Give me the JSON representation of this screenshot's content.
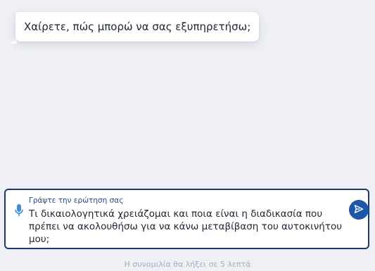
{
  "chat": {
    "bot_message": "Χαίρετε, πώς μπορώ να σας εξυπηρετήσω;"
  },
  "composer": {
    "label": "Γράψτε την ερώτηση σας",
    "value": "Τι δικαιολογητικά χρειάζομαι και ποια είναι η διαδικασία που πρέπει να ακολουθήσω για να κάνω μεταβίβαση του αυτοκινήτου μου;",
    "mic_icon": "microphone-icon",
    "send_icon": "send-icon",
    "border_color": "#1a3a6e",
    "accent_color": "#1f56a8"
  },
  "footer": {
    "session_note": "Η συνομιλία θα λήξει σε 5 λεπτά"
  }
}
